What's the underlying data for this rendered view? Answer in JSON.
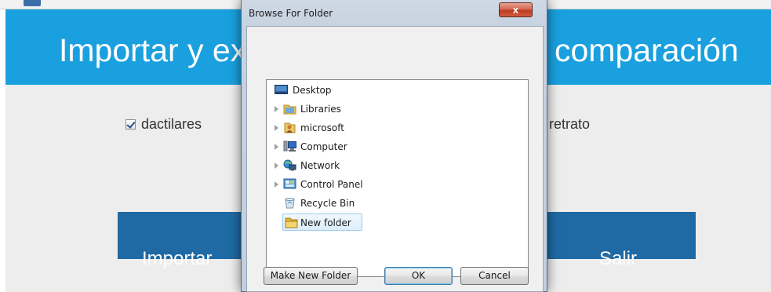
{
  "app": {
    "title_left": "Importar y ex",
    "title_right": "comparación",
    "option_dactilares": "dactilares",
    "option_retrato": "retrato",
    "btn_importar": "Importar",
    "btn_salir": "Salir",
    "header_color": "#1aa0df",
    "button_color": "#1f6aa5"
  },
  "dialog": {
    "title": "Browse For Folder",
    "close_label": "x",
    "tree": [
      {
        "label": "Desktop",
        "icon": "desktop-icon",
        "expandable": false
      },
      {
        "label": "Libraries",
        "icon": "libraries-icon",
        "expandable": true
      },
      {
        "label": "microsoft",
        "icon": "user-folder-icon",
        "expandable": true
      },
      {
        "label": "Computer",
        "icon": "computer-icon",
        "expandable": true
      },
      {
        "label": "Network",
        "icon": "network-icon",
        "expandable": true
      },
      {
        "label": "Control Panel",
        "icon": "control-panel-icon",
        "expandable": true
      },
      {
        "label": "Recycle Bin",
        "icon": "recycle-bin-icon",
        "expandable": false
      },
      {
        "label": "New folder",
        "icon": "folder-icon",
        "expandable": false,
        "selected": true
      }
    ],
    "btn_make_new_folder": "Make New Folder",
    "btn_ok": "OK",
    "btn_cancel": "Cancel"
  }
}
